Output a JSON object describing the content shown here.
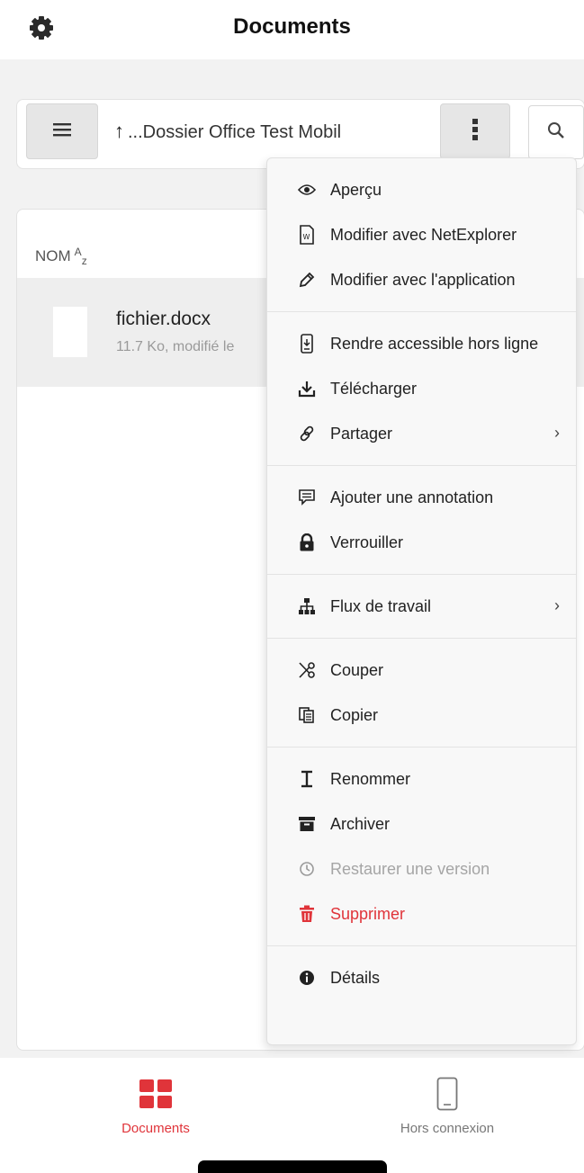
{
  "header": {
    "title": "Documents",
    "settings_icon": "gear-icon"
  },
  "toolbar": {
    "menu_icon": "hamburger-icon",
    "breadcrumb_arrow": "↑",
    "breadcrumb_text": "...Dossier Office Test Mobil",
    "more_icon": "vertical-dots-icon",
    "search_icon": "search-icon"
  },
  "list": {
    "column_header": "NOM",
    "sort_indicator_top": "A",
    "sort_indicator_bottom": "z",
    "files": [
      {
        "name": "fichier.docx",
        "meta": "11.7 Ko, modifié le"
      }
    ]
  },
  "context_menu": {
    "groups": [
      [
        {
          "label": "Aperçu",
          "icon": "eye-icon"
        },
        {
          "label": "Modifier avec NetExplorer",
          "icon": "word-doc-icon"
        },
        {
          "label": "Modifier avec l'application",
          "icon": "pencil-icon"
        }
      ],
      [
        {
          "label": "Rendre accessible hors ligne",
          "icon": "phone-download-icon"
        },
        {
          "label": "Télécharger",
          "icon": "download-icon"
        },
        {
          "label": "Partager",
          "icon": "link-icon",
          "chevron": "›"
        }
      ],
      [
        {
          "label": "Ajouter une annotation",
          "icon": "comment-icon"
        },
        {
          "label": "Verrouiller",
          "icon": "lock-icon"
        }
      ],
      [
        {
          "label": "Flux de travail",
          "icon": "workflow-icon",
          "chevron": "›"
        }
      ],
      [
        {
          "label": "Couper",
          "icon": "scissors-icon"
        },
        {
          "label": "Copier",
          "icon": "copy-icon"
        }
      ],
      [
        {
          "label": "Renommer",
          "icon": "text-cursor-icon"
        },
        {
          "label": "Archiver",
          "icon": "archive-icon"
        },
        {
          "label": "Restaurer une version",
          "icon": "clock-icon",
          "disabled": true
        },
        {
          "label": "Supprimer",
          "icon": "trash-icon",
          "danger": true
        }
      ],
      [
        {
          "label": "Détails",
          "icon": "info-icon"
        }
      ]
    ]
  },
  "tabbar": {
    "tabs": [
      {
        "label": "Documents",
        "icon": "grid-icon",
        "active": true
      },
      {
        "label": "Hors connexion",
        "icon": "phone-icon",
        "active": false
      }
    ]
  },
  "colors": {
    "accent": "#e0343a",
    "background": "#f2f2f2",
    "menu_background": "#f8f8f8",
    "disabled": "#a5a5a5"
  }
}
